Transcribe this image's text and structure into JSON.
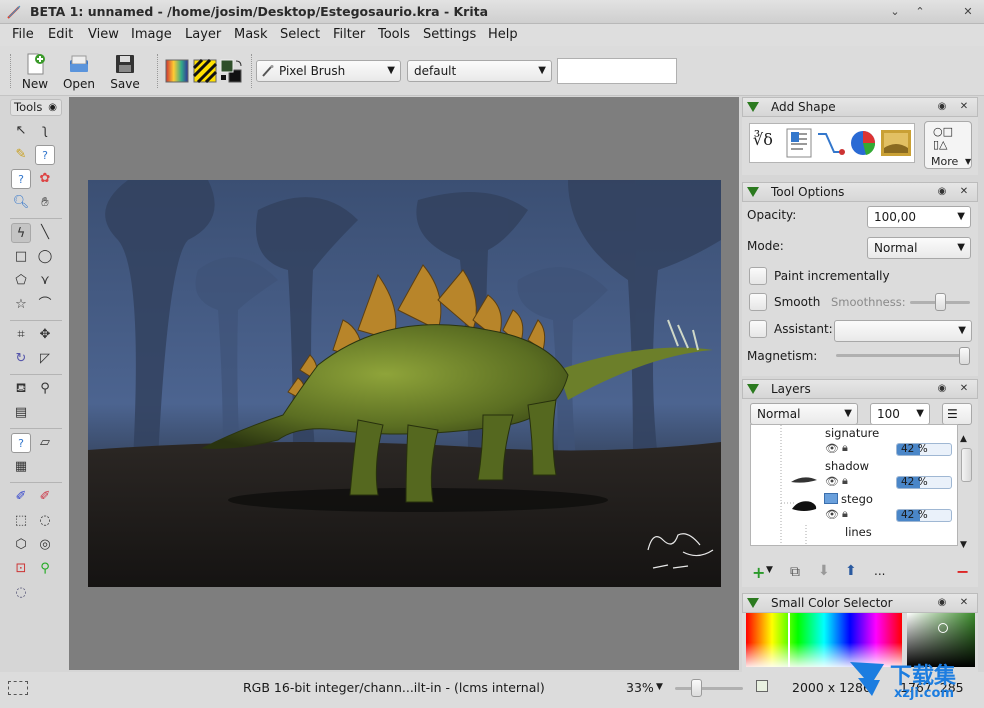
{
  "window": {
    "title": "BETA 1: unnamed - /home/josim/Desktop/Estegosaurio.kra - Krita",
    "controls": [
      "⌄",
      "⌃",
      "✕"
    ]
  },
  "menu": [
    "File",
    "Edit",
    "View",
    "Image",
    "Layer",
    "Mask",
    "Select",
    "Filter",
    "Tools",
    "Settings",
    "Help"
  ],
  "toolbar": {
    "new_label": "New",
    "open_label": "Open",
    "save_label": "Save",
    "brush_preset": "Pixel Brush",
    "paintop_preset": "default",
    "preset_search_value": ""
  },
  "toolbox": {
    "title": "Tools"
  },
  "dockers": {
    "add_shape": {
      "title": "Add Shape",
      "more_label": "More"
    },
    "tool_options": {
      "title": "Tool Options",
      "opacity_label": "Opacity:",
      "opacity_value": "100,00",
      "mode_label": "Mode:",
      "mode_value": "Normal",
      "paint_incrementally_label": "Paint incrementally",
      "smooth_label": "Smooth",
      "smoothness_label": "Smoothness:",
      "assistant_label": "Assistant:",
      "assistant_value": "",
      "magnetism_label": "Magnetism:"
    },
    "layers": {
      "title": "Layers",
      "blend_mode": "Normal",
      "opacity": "100",
      "items": [
        {
          "name": "signature",
          "opacity_text": "42 %",
          "opacity": 0.42
        },
        {
          "name": "shadow",
          "opacity_text": "42 %",
          "opacity": 0.42
        },
        {
          "name": "stego",
          "opacity_text": "42 %",
          "opacity": 0.42
        },
        {
          "name": "lines"
        }
      ],
      "more_label": "..."
    },
    "color_selector": {
      "title": "Small Color Selector"
    }
  },
  "status": {
    "color_model": "RGB 16-bit integer/chann...ilt-in - (lcms internal)",
    "zoom": "33%",
    "image_size": "2000 x 1286",
    "cursor_pos": "1767, 285"
  },
  "watermark": {
    "text": "下载集",
    "sub": "xzji.com"
  },
  "colors": {
    "accent_green": "#2b7a1f",
    "layer_opacity_fill": "#4a86c8",
    "canvas_bg": "#7e7e7e"
  }
}
